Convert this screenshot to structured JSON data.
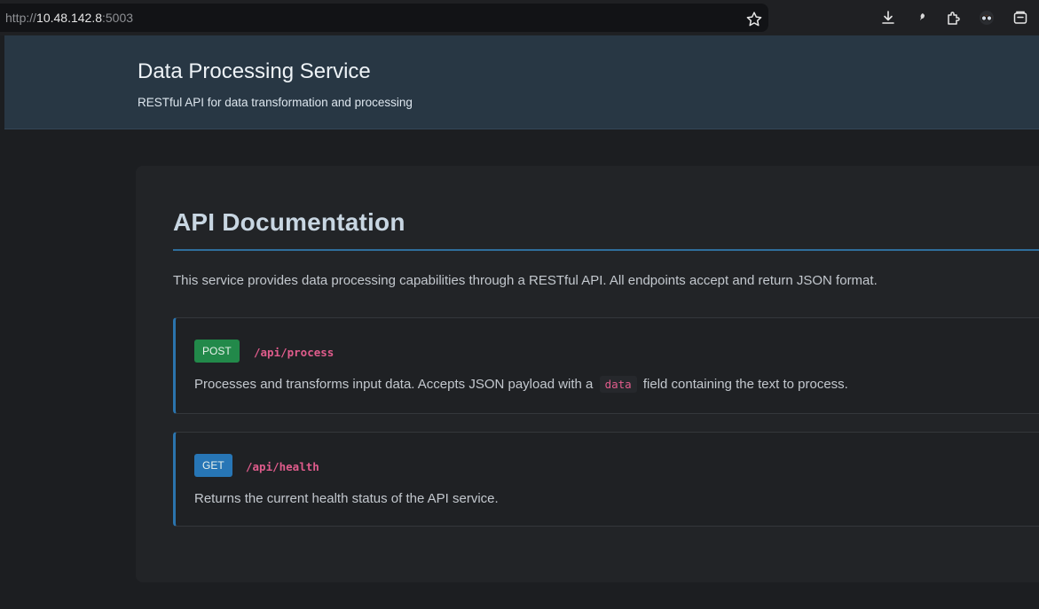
{
  "browser": {
    "url_scheme": "http://",
    "url_host": "10.48.142.8",
    "url_port": ":5003",
    "icons": [
      "star-icon",
      "download-icon",
      "extension-leaf-icon",
      "puzzle-icon",
      "profile-icon",
      "screenshot-icon"
    ]
  },
  "header": {
    "title": "Data Processing Service",
    "subtitle": "RESTful API for data transformation and processing"
  },
  "docs": {
    "title": "API Documentation",
    "intro": "This service provides data processing capabilities through a RESTful API. All endpoints accept and return JSON format.",
    "endpoints": [
      {
        "method": "POST",
        "path": "/api/process",
        "desc_before": "Processes and transforms input data. Accepts JSON payload with a",
        "code": "data",
        "desc_after": "field containing the text to process."
      },
      {
        "method": "GET",
        "path": "/api/health",
        "desc": "Returns the current health status of the API service."
      }
    ]
  },
  "colors": {
    "header_bg": "#283744",
    "post_badge": "#22894a",
    "get_badge": "#2776b6",
    "path_pink": "#e05c8c",
    "accent_blue": "#2b74ad"
  }
}
